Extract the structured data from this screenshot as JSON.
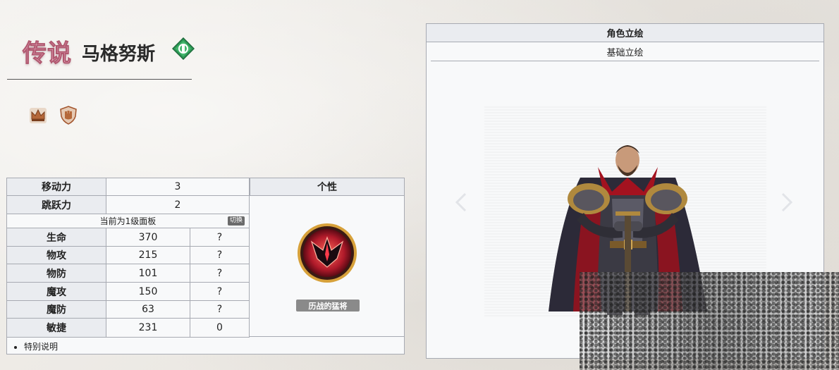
{
  "header": {
    "rarity": "传说",
    "name": "马格努斯",
    "element_badge_icon": "green-diamond-element-icon",
    "trait_icons": [
      "crown-icon",
      "fist-shield-icon"
    ]
  },
  "stats_table": {
    "move_label": "移动力",
    "move_value": "3",
    "jump_label": "跳跃力",
    "jump_value": "2",
    "personality_header": "个性",
    "panel_note": "当前为1级面板",
    "switch_label": "切换",
    "rows": [
      {
        "label": "生命",
        "value": "370",
        "growth": "?"
      },
      {
        "label": "物攻",
        "value": "215",
        "growth": "?"
      },
      {
        "label": "物防",
        "value": "101",
        "growth": "?"
      },
      {
        "label": "魔攻",
        "value": "150",
        "growth": "?"
      },
      {
        "label": "魔防",
        "value": "63",
        "growth": "?"
      },
      {
        "label": "敏捷",
        "value": "231",
        "growth": "0"
      }
    ],
    "personality_skill": "历战的猛将",
    "skill_icon": "winged-emblem-icon",
    "notes": [
      "特别说明"
    ]
  },
  "portrait": {
    "title": "角色立绘",
    "tab": "基础立绘"
  },
  "colors": {
    "table_border": "#a7aab2",
    "header_bg": "#eaecf0",
    "cell_bg": "#f8f9fa",
    "rarity_pink": "#f3b9cf",
    "element_green": "#2e9a57"
  }
}
